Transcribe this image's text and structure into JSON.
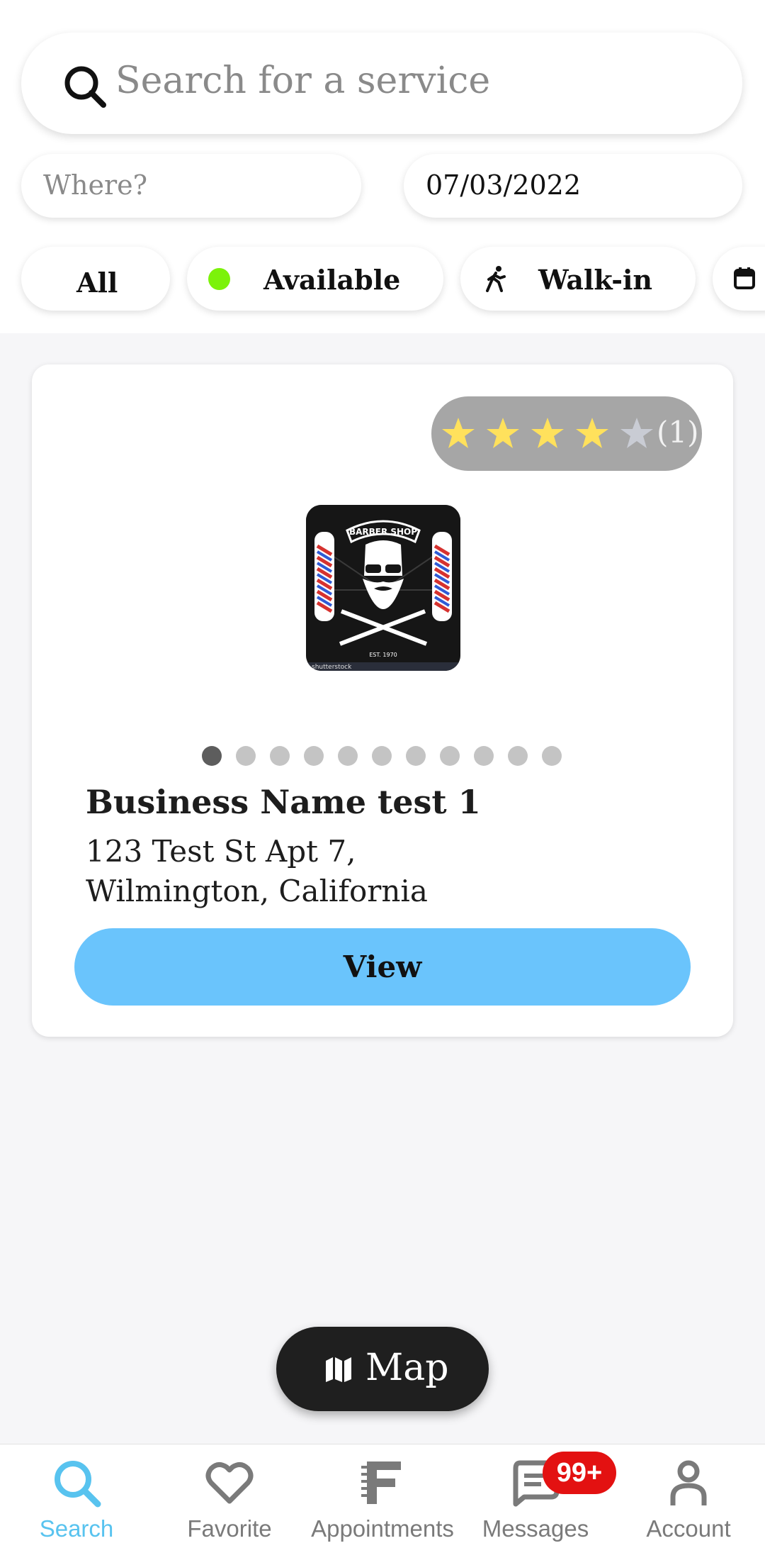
{
  "search": {
    "placeholder": "Search for a service",
    "where_placeholder": "Where?",
    "date_value": "07/03/2022"
  },
  "filters": {
    "chips": [
      {
        "label": "All"
      },
      {
        "label": "Available",
        "indicator_color": "#7cf20a"
      },
      {
        "label": "Walk-in",
        "icon": "walking-person-icon"
      },
      {
        "label": "",
        "icon": "calendar-icon"
      }
    ]
  },
  "listing": {
    "rating": {
      "stars": 4,
      "max": 5,
      "count_text": "(1)",
      "star_color": "#ffe15c",
      "empty_star_color": "#c9ccd4"
    },
    "logo": {
      "banner_text": "BARBER SHOP",
      "est_text": "EST. 1970",
      "watermark": "shutterstock"
    },
    "carousel": {
      "total": 11,
      "active_index": 0
    },
    "business_name": "Business Name test 1",
    "address_line1": "123 Test St Apt 7,",
    "address_line2": "Wilmington, California",
    "view_label": "View",
    "view_color": "#6ac4fc"
  },
  "map_button": {
    "label": "Map"
  },
  "bottom_nav": {
    "items": [
      {
        "label": "Search",
        "icon": "search-icon",
        "active": true
      },
      {
        "label": "Favorite",
        "icon": "heart-icon"
      },
      {
        "label": "Appointments",
        "icon": "appointments-icon"
      },
      {
        "label": "Messages",
        "icon": "message-icon",
        "badge": "99+"
      },
      {
        "label": "Account",
        "icon": "account-icon"
      }
    ],
    "active_color": "#58c3ef"
  }
}
